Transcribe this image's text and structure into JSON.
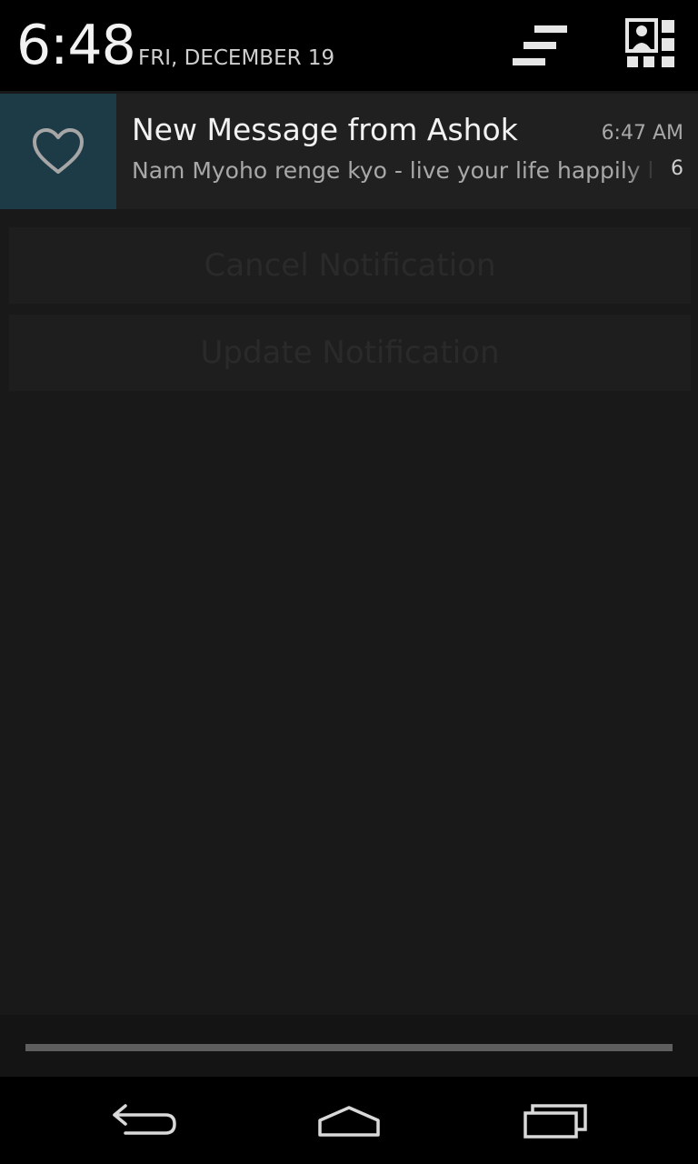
{
  "status": {
    "time": "6:48",
    "date": "FRI, DECEMBER 19"
  },
  "header_icons": {
    "clear_all": "clear-all-icon",
    "quick_settings": "quick-settings-icon"
  },
  "background_app": {
    "buttons": [
      {
        "label": "Cancel Notification"
      },
      {
        "label": "Update Notification"
      }
    ]
  },
  "notification": {
    "icon": "heart-icon",
    "title": "New Message from Ashok",
    "time": "6:47 AM",
    "text": "Nam Myoho renge kyo - live your life happily li",
    "number": "6"
  },
  "nav": {
    "back": "back-icon",
    "home": "home-icon",
    "recents": "recents-icon"
  },
  "colors": {
    "icon_background": "#1d3b47",
    "shade_background": "#000000",
    "notification_background": "#202020"
  }
}
